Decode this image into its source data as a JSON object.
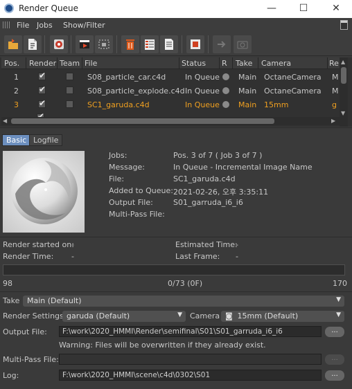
{
  "window": {
    "title": "Render Queue",
    "minimize_glyph": "—",
    "maximize_glyph": "☐",
    "close_glyph": "✕"
  },
  "menu": [
    "File",
    "Jobs",
    "Show/Filter"
  ],
  "toolbar_icons": [
    "open-file-icon",
    "new-job-icon",
    "render-settings-icon",
    "start-render-icon",
    "render-region-icon",
    "delete-job-icon",
    "job-list-icon",
    "job-doc-icon",
    "stop-icon",
    "team-render-icon",
    "camera-snapshot-icon"
  ],
  "table": {
    "columns": [
      "Pos.",
      "Render",
      "Team",
      "File",
      "Status",
      "R",
      "Take",
      "Camera",
      "Re"
    ],
    "rows": [
      {
        "pos": "1",
        "render": true,
        "team": false,
        "file": "S08_particle_car.c4d",
        "status": "In Queue",
        "take": "Main",
        "camera": "OctaneCamera",
        "re": "M",
        "selected": false
      },
      {
        "pos": "2",
        "render": true,
        "team": false,
        "file": "S08_particle_explode.c4d",
        "status": "In Queue",
        "take": "Main",
        "camera": "OctaneCamera",
        "re": "M",
        "selected": false
      },
      {
        "pos": "3",
        "render": true,
        "team": false,
        "file": "SC1_garuda.c4d",
        "status": "In Queue",
        "take": "Main",
        "camera": "15mm",
        "re": "g",
        "selected": true
      }
    ]
  },
  "tabs": {
    "basic": "Basic",
    "logfile": "Logfile"
  },
  "details": {
    "jobs_label": "Jobs:",
    "jobs_value": "Pos. 3 of 7 ( Job 3 of 7 )",
    "message_label": "Message:",
    "message_value": "In Queue - Incremental Image Name",
    "file_label": "File:",
    "file_value": "SC1_garuda.c4d",
    "added_label": "Added to Queue:",
    "added_value": "2021-02-26, 오후 3:35:11",
    "output_label": "Output File:",
    "output_value": "S01_garruda_i6_i6",
    "multipass_label": "Multi-Pass File:"
  },
  "timing": {
    "render_started_label": "Render started on:",
    "render_started_value": "-",
    "render_time_label": "Render Time:",
    "render_time_value": "-",
    "estimated_label": "Estimated Time:",
    "estimated_value": "-",
    "last_frame_label": "Last Frame:",
    "last_frame_value": "-"
  },
  "progress": {
    "fraction": 0,
    "start": "98",
    "center": "0/73 (0F)",
    "end": "170"
  },
  "settings": {
    "take_label": "Take",
    "take_value": "Main (Default)",
    "render_settings_label": "Render Settings",
    "render_settings_value": "garuda (Default)",
    "camera_label": "Camera",
    "camera_value": "15mm (Default)",
    "output_file_label": "Output File:",
    "output_file_value": "F:\\work\\2020_HMMI\\Render\\semifinal\\S01\\S01_garruda_i6_i6",
    "warning": "Warning: Files will be overwritten if they already exist.",
    "multipass_label": "Multi-Pass File:",
    "multipass_value": "",
    "log_label": "Log:",
    "log_value": "F:\\work\\2020_HMMI\\scene\\c4d\\0302\\S01",
    "browse_label": "..."
  },
  "colors": {
    "accent": "#6c8fbf",
    "selected_row": "#f0a020",
    "background": "#3a3a3a"
  }
}
